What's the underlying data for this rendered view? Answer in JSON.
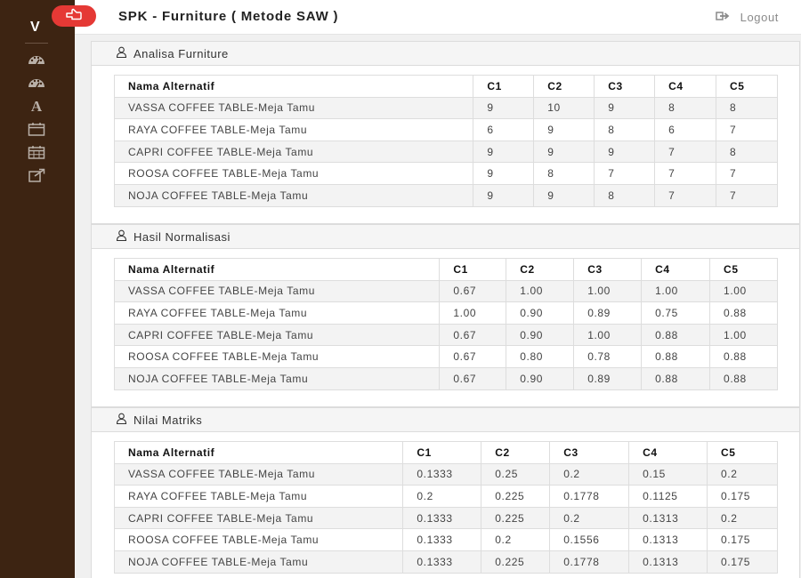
{
  "app": {
    "brand_letter": "V",
    "title": "SPK - Furniture ( Metode SAW )",
    "logout_label": "Logout"
  },
  "sidebar": {
    "icons": [
      "dashboard-icon",
      "dashboard-icon",
      "font-icon",
      "calendar-icon",
      "calendar-grid-icon",
      "external-link-icon"
    ]
  },
  "colors": {
    "sidebar_bg": "#3d2412",
    "toggle_red": "#e53935"
  },
  "columns": [
    "Nama Alternatif",
    "C1",
    "C2",
    "C3",
    "C4",
    "C5"
  ],
  "panels": {
    "analisa": {
      "title": "Analisa Furniture",
      "rows": [
        [
          "VASSA COFFEE TABLE-Meja Tamu",
          "9",
          "10",
          "9",
          "8",
          "8"
        ],
        [
          "RAYA COFFEE TABLE-Meja Tamu",
          "6",
          "9",
          "8",
          "6",
          "7"
        ],
        [
          "CAPRI COFFEE TABLE-Meja Tamu",
          "9",
          "9",
          "9",
          "7",
          "8"
        ],
        [
          "ROOSA COFFEE TABLE-Meja Tamu",
          "9",
          "8",
          "7",
          "7",
          "7"
        ],
        [
          "NOJA COFFEE TABLE-Meja Tamu",
          "9",
          "9",
          "8",
          "7",
          "7"
        ]
      ]
    },
    "normalisasi": {
      "title": "Hasil Normalisasi",
      "rows": [
        [
          "VASSA COFFEE TABLE-Meja Tamu",
          "0.67",
          "1.00",
          "1.00",
          "1.00",
          "1.00"
        ],
        [
          "RAYA COFFEE TABLE-Meja Tamu",
          "1.00",
          "0.90",
          "0.89",
          "0.75",
          "0.88"
        ],
        [
          "CAPRI COFFEE TABLE-Meja Tamu",
          "0.67",
          "0.90",
          "1.00",
          "0.88",
          "1.00"
        ],
        [
          "ROOSA COFFEE TABLE-Meja Tamu",
          "0.67",
          "0.80",
          "0.78",
          "0.88",
          "0.88"
        ],
        [
          "NOJA COFFEE TABLE-Meja Tamu",
          "0.67",
          "0.90",
          "0.89",
          "0.88",
          "0.88"
        ]
      ]
    },
    "matriks": {
      "title": "Nilai Matriks",
      "rows": [
        [
          "VASSA COFFEE TABLE-Meja Tamu",
          "0.1333",
          "0.25",
          "0.2",
          "0.15",
          "0.2"
        ],
        [
          "RAYA COFFEE TABLE-Meja Tamu",
          "0.2",
          "0.225",
          "0.1778",
          "0.1125",
          "0.175"
        ],
        [
          "CAPRI COFFEE TABLE-Meja Tamu",
          "0.1333",
          "0.225",
          "0.2",
          "0.1313",
          "0.2"
        ],
        [
          "ROOSA COFFEE TABLE-Meja Tamu",
          "0.1333",
          "0.2",
          "0.1556",
          "0.1313",
          "0.175"
        ],
        [
          "NOJA COFFEE TABLE-Meja Tamu",
          "0.1333",
          "0.225",
          "0.1778",
          "0.1313",
          "0.175"
        ]
      ]
    }
  }
}
